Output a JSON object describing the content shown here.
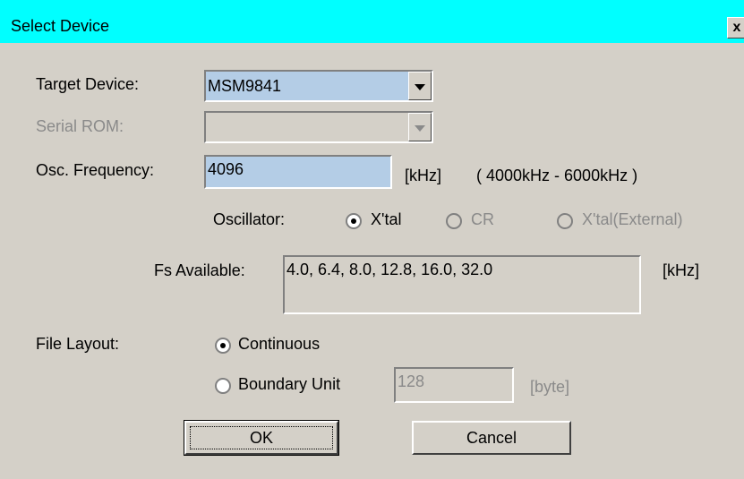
{
  "window": {
    "title": "Select Device",
    "close_label": "x"
  },
  "target_device": {
    "label": "Target Device:",
    "value": "MSM9841"
  },
  "serial_rom": {
    "label": "Serial ROM:",
    "value": ""
  },
  "osc_frequency": {
    "label": "Osc. Frequency:",
    "value": "4096",
    "unit": "[kHz]",
    "range": "( 4000kHz - 6000kHz )"
  },
  "oscillator": {
    "label": "Oscillator:",
    "options": [
      {
        "label": "X'tal",
        "selected": true,
        "enabled": true
      },
      {
        "label": "CR",
        "selected": false,
        "enabled": false
      },
      {
        "label": "X'tal(External)",
        "selected": false,
        "enabled": false
      }
    ]
  },
  "fs_available": {
    "label": "Fs Available:",
    "value": "4.0,  6.4,  8.0,  12.8,  16.0,  32.0",
    "unit": "[kHz]"
  },
  "file_layout": {
    "label": "File Layout:",
    "options": [
      {
        "label": "Continuous",
        "selected": true
      },
      {
        "label": "Boundary Unit",
        "selected": false
      }
    ],
    "boundary_value": "128",
    "boundary_unit": "[byte]"
  },
  "buttons": {
    "ok": "OK",
    "cancel": "Cancel"
  }
}
